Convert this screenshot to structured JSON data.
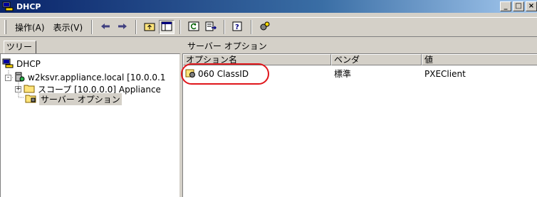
{
  "window": {
    "title": "DHCP",
    "buttons": [
      "_",
      "□",
      "×"
    ]
  },
  "toolbar": {
    "menu_action": "操作(A)",
    "menu_view": "表示(V)",
    "icons": [
      "back-arrow-icon",
      "forward-arrow-icon",
      "up-folder-icon",
      "show-tree-icon",
      "refresh-icon",
      "export-list-icon",
      "help-icon",
      "dhcp-options-icon"
    ]
  },
  "left_pane": {
    "tab_label": "ツリー",
    "tree": [
      {
        "label": "DHCP",
        "icon": "dhcp-icon"
      },
      {
        "label": "w2ksvr.appliance.local [10.0.0.1",
        "icon": "server-icon",
        "expander": "-"
      },
      {
        "label": "スコープ [10.0.0.0] Appliance",
        "icon": "folder-icon",
        "expander": "+"
      },
      {
        "label": "サーバー オプション",
        "icon": "options-folder-icon",
        "selected": true
      }
    ]
  },
  "right_pane": {
    "title": "サーバー オプション",
    "columns": [
      "オプション名",
      "ベンダ",
      "値"
    ],
    "rows": [
      {
        "name": "060 ClassID",
        "vendor": "標準",
        "value": "PXEClient",
        "icon": "option-icon"
      }
    ]
  },
  "colors": {
    "highlight_circle": "#e0161b",
    "titlebar_start": "#0a246a"
  }
}
